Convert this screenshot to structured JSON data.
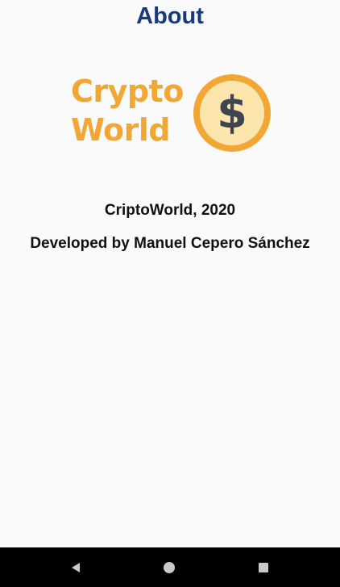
{
  "header": {
    "title": "About"
  },
  "logo": {
    "line1": "Crypto",
    "line2": "World",
    "symbol": "$",
    "colors": {
      "text": "#f2a734",
      "coin_ring": "#f2a734",
      "coin_fill": "#fde6ad",
      "symbol": "#3f4550"
    }
  },
  "info": {
    "year_line": "CriptoWorld, 2020",
    "developer_line": "Developed by Manuel Cepero Sánchez"
  },
  "navigation_bar": {
    "buttons": [
      {
        "name": "back",
        "icon": "triangle-back-icon"
      },
      {
        "name": "home",
        "icon": "circle-home-icon"
      },
      {
        "name": "recents",
        "icon": "square-recents-icon"
      }
    ]
  },
  "colors": {
    "title": "#183a7a",
    "background": "#fafafa",
    "navbar": "#000000"
  }
}
